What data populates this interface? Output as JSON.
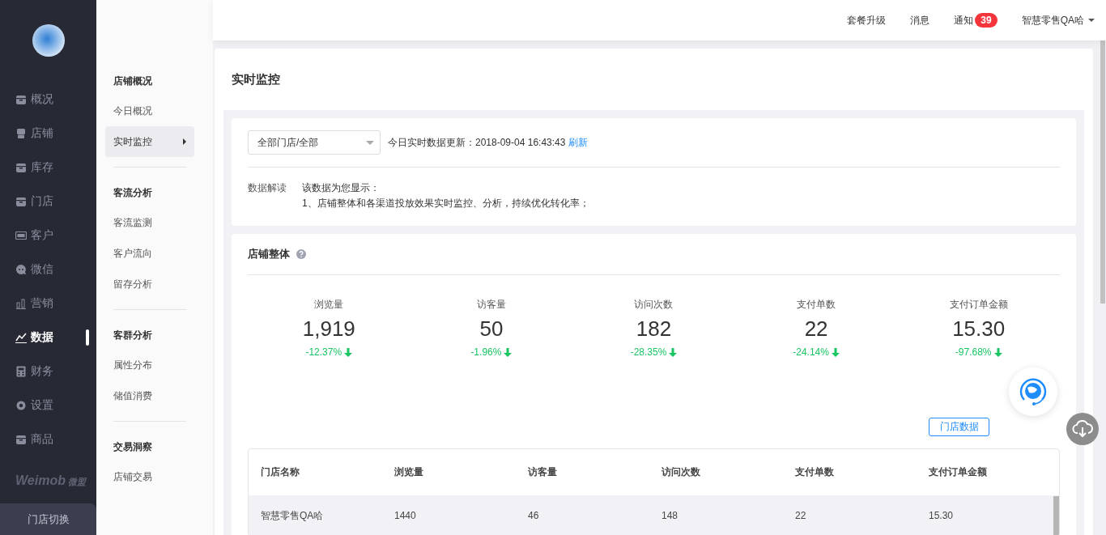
{
  "sidebar": {
    "items": [
      {
        "label": "概况",
        "kind": "box",
        "selected": false
      },
      {
        "label": "店铺",
        "kind": "store",
        "selected": false
      },
      {
        "label": "库存",
        "kind": "box",
        "selected": false
      },
      {
        "label": "门店",
        "kind": "box",
        "selected": false
      },
      {
        "label": "客户",
        "kind": "vip",
        "selected": false
      },
      {
        "label": "微信",
        "kind": "chat",
        "selected": false
      },
      {
        "label": "营销",
        "kind": "bars",
        "selected": false
      },
      {
        "label": "数据",
        "kind": "trend",
        "selected": true
      },
      {
        "label": "财务",
        "kind": "calc",
        "selected": false
      },
      {
        "label": "设置",
        "kind": "gear",
        "selected": false
      },
      {
        "label": "商品",
        "kind": "box",
        "selected": false
      }
    ],
    "brand": {
      "name": "Weimob",
      "suffix": "微盟"
    },
    "store_switch": "门店切换"
  },
  "subnav": {
    "groups": [
      {
        "title": "店铺概况",
        "items": [
          {
            "label": "今日概况",
            "selected": false
          },
          {
            "label": "实时监控",
            "selected": true
          }
        ]
      },
      {
        "title": "客流分析",
        "items": [
          {
            "label": "客流监测",
            "selected": false
          },
          {
            "label": "客户流向",
            "selected": false
          },
          {
            "label": "留存分析",
            "selected": false
          }
        ]
      },
      {
        "title": "客群分析",
        "items": [
          {
            "label": "属性分布",
            "selected": false
          },
          {
            "label": "储值消费",
            "selected": false
          }
        ]
      },
      {
        "title": "交易洞察",
        "items": [
          {
            "label": "店铺交易",
            "selected": false
          }
        ]
      }
    ]
  },
  "topbar": {
    "links": [
      {
        "label": "套餐升级"
      },
      {
        "label": "消息"
      },
      {
        "label": "通知",
        "badge": "39"
      }
    ],
    "user": "智慧零售QA哈"
  },
  "page": {
    "title": "实时监控",
    "store_select": {
      "value": "全部门店/全部"
    },
    "update_text": "今日实时数据更新：2018-09-04 16:43:43",
    "refresh": "刷新",
    "interpretation": {
      "label": "数据解读",
      "lines": [
        "该数据为您显示：",
        "1、店铺整体和各渠道投放效果实时监控、分析，持续优化转化率；"
      ]
    }
  },
  "overview": {
    "title": "店铺整体",
    "metrics": [
      {
        "label": "浏览量",
        "value": "1,919",
        "change": "-12.37%",
        "kind": "down"
      },
      {
        "label": "访客量",
        "value": "50",
        "change": "-1.96%",
        "kind": "down"
      },
      {
        "label": "访问次数",
        "value": "182",
        "change": "-28.35%",
        "kind": "down"
      },
      {
        "label": "支付单数",
        "value": "22",
        "change": "-24.14%",
        "kind": "down"
      },
      {
        "label": "支付订单金额",
        "value": "15.30",
        "change": "-97.68%",
        "kind": "down"
      }
    ],
    "store_data_button": "门店数据"
  },
  "table": {
    "columns": [
      "门店名称",
      "浏览量",
      "访客量",
      "访问次数",
      "支付单数",
      "支付订单金额"
    ],
    "rows": [
      [
        "智慧零售QA哈",
        "1440",
        "46",
        "148",
        "22",
        "15.30"
      ]
    ]
  }
}
